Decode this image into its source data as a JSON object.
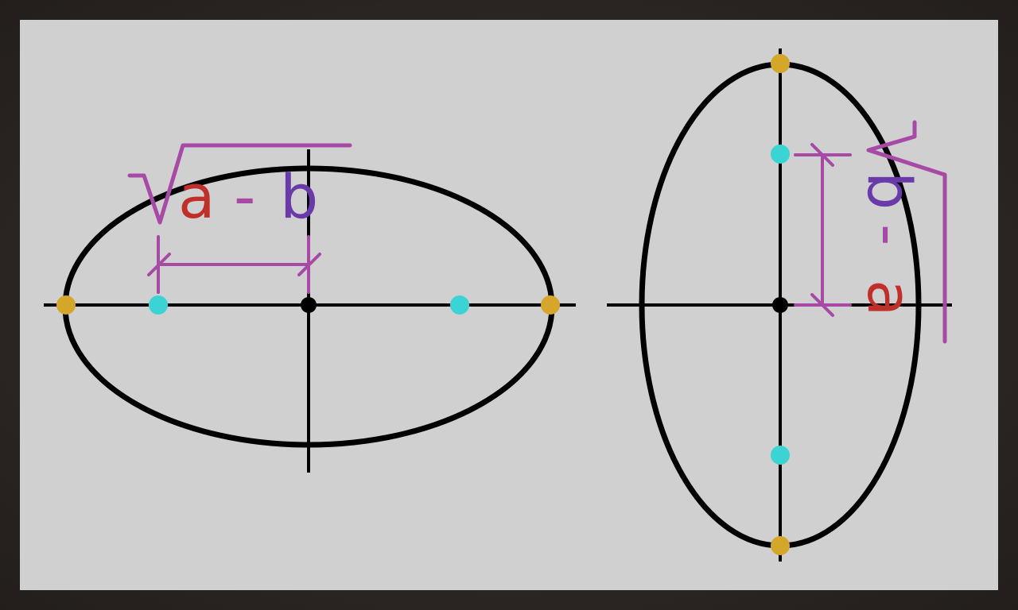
{
  "colors": {
    "board": "#d0d0d0",
    "frame": "#2a2422",
    "curve": "#000000",
    "bracket": "#a64aa6",
    "term_a": "#c0302a",
    "term_b": "#6a3aa8",
    "vertex_point": "#d4a62a",
    "focus_point": "#3ad4d4",
    "center_point": "#000000"
  },
  "left_diagram": {
    "orientation": "horizontal",
    "expression": {
      "a": "a",
      "minus": "-",
      "b": "b"
    },
    "points": [
      "vertex",
      "focus",
      "center",
      "focus",
      "vertex"
    ]
  },
  "right_diagram": {
    "orientation": "vertical",
    "expression": {
      "a": "a",
      "minus": "-",
      "b": "b"
    },
    "points": [
      "vertex",
      "focus",
      "center",
      "focus",
      "vertex"
    ]
  }
}
